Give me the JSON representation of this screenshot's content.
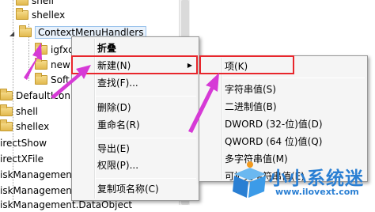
{
  "tree": {
    "items": [
      {
        "label": "shell",
        "indent": 1,
        "folder": true
      },
      {
        "label": "shellex",
        "indent": 1,
        "folder": true
      },
      {
        "label": "ContextMenuHandlers",
        "indent": 2,
        "folder": true,
        "selected": true
      },
      {
        "label": "igfxc",
        "indent": 3,
        "folder": true
      },
      {
        "label": "new",
        "indent": 3,
        "folder": true
      },
      {
        "label": "Soft",
        "indent": 3,
        "folder": true
      },
      {
        "label": "DefaultIcon",
        "indent": 0,
        "folder": true
      },
      {
        "label": "shell",
        "indent": 0,
        "folder": true
      },
      {
        "label": "shellex",
        "indent": 0,
        "folder": true
      },
      {
        "label": "irectShow",
        "indent": 0,
        "folder": false
      },
      {
        "label": "irectXFile",
        "indent": 0,
        "folder": false
      },
      {
        "label": "iskManagement",
        "indent": 0,
        "folder": false
      },
      {
        "label": "iskManagement",
        "indent": 0,
        "folder": false
      },
      {
        "label": "iskManagement.DataObject",
        "indent": 0,
        "folder": false
      }
    ]
  },
  "context_menu": {
    "collapse": "折叠",
    "new": "新建(N)",
    "find": "查找(F)...",
    "delete": "删除(D)",
    "rename": "重命名(R)",
    "export": "导出(E)",
    "permissions": "权限(P)...",
    "copy_key_name": "复制项名称(C)"
  },
  "submenu": {
    "key": "项(K)",
    "string_value": "字符串值(S)",
    "binary_value": "二进制值(B)",
    "dword_value": "DWORD (32-位)值(D)",
    "qword_value": "QWORD (64 位)值(Q)",
    "multi_string_value": "多字符串值(M)",
    "expandable_string_value": "可扩充字符串值(E)"
  },
  "watermark": {
    "title": "小小系统迷",
    "url": "www.ilovext.com"
  },
  "colors": {
    "highlight_box": "#e8262c",
    "arrow": "#d63ad6",
    "watermark": "#2a7fd3"
  }
}
